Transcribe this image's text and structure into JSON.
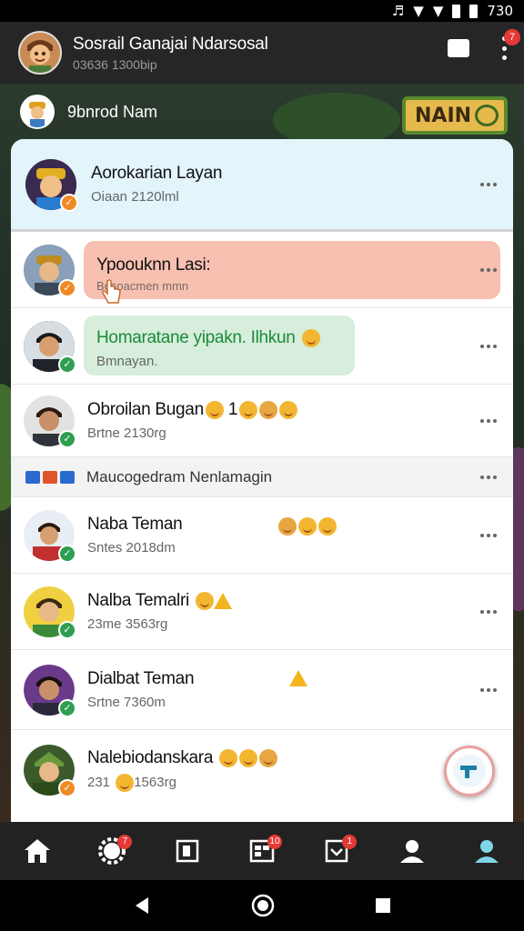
{
  "status_bar": {
    "time": "730"
  },
  "header": {
    "title": "Sosrail Ganajai Ndarsosal",
    "subtitle": "03636 1300bip",
    "menu_badge": "7"
  },
  "background": {
    "sign_text": "NAIN"
  },
  "current_user": {
    "name": "9bnrod Nam"
  },
  "pinned": {
    "name": "Aorokarian Layan",
    "sub": "Oiaan 2120lml"
  },
  "chats": [
    {
      "name": "Ypoouknn Lasi:",
      "sub": "Bosoacmen mmn",
      "style": "red"
    },
    {
      "name": "Homaratane yipakn. Ilhkun",
      "sub": "Bmnayan.",
      "style": "green"
    },
    {
      "name": "Obroilan Bugan",
      "name_suffix": "1",
      "sub": "Brtne 2130rg",
      "style": "plain"
    }
  ],
  "section": {
    "label": "Maucogedram Nenlamagin"
  },
  "chats2": [
    {
      "name": "Naba Teman",
      "sub": "Sntes 2018dm"
    },
    {
      "name": "Nalba Temalri",
      "sub": "23me 3563rg"
    },
    {
      "name": "Dialbat Teman",
      "sub": "Srtne 7360m"
    },
    {
      "name": "Nalebiodanskara",
      "sub_prefix": "231",
      "sub_suffix": "1563rg"
    }
  ],
  "nav": {
    "badges": [
      "7",
      "10",
      "1"
    ]
  },
  "colors": {
    "accent": "#2e9e4f",
    "badge": "#e53935",
    "pinned_bg": "#e3f4fa"
  }
}
